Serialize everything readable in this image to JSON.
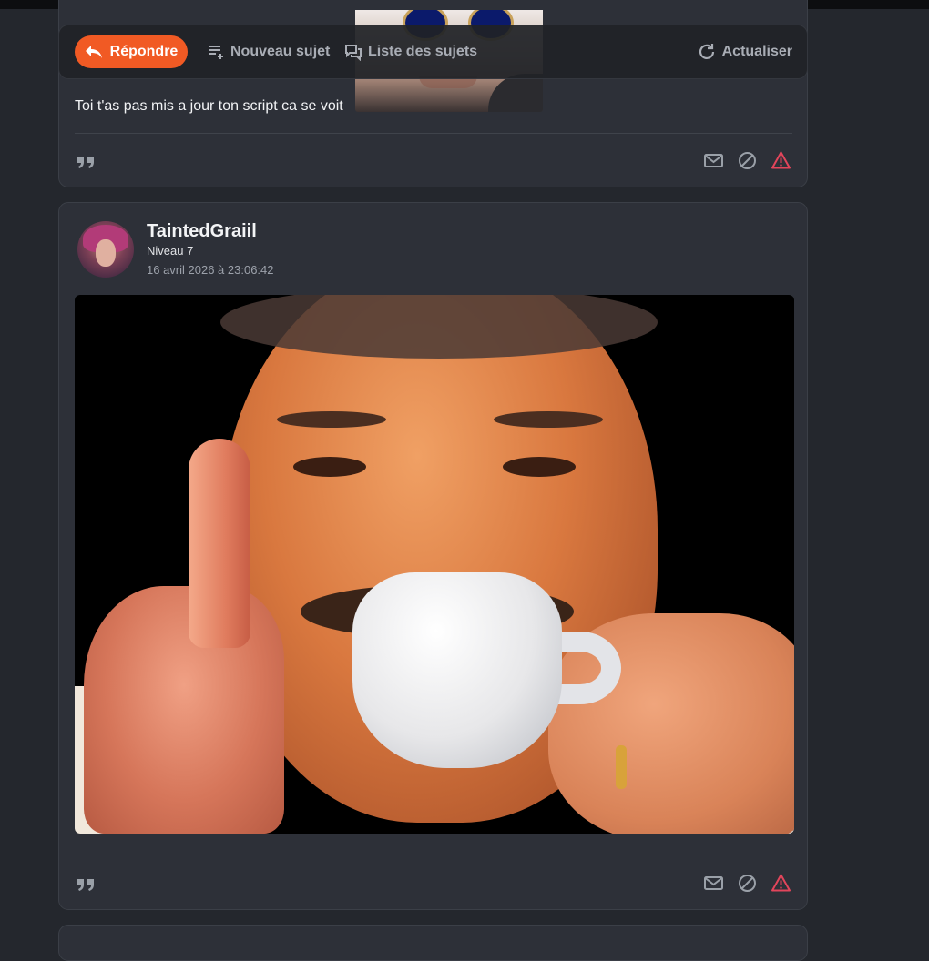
{
  "toolbar": {
    "reply_label": "Répondre",
    "new_topic_label": "Nouveau sujet",
    "topic_list_label": "Liste des sujets",
    "refresh_label": "Actualiser",
    "reply_color": "#f15a24"
  },
  "posts": [
    {
      "text": "Toi t'as pas mis a jour ton script ca se voit",
      "actions": [
        "quote-icon",
        "mail-icon",
        "block-icon",
        "report-icon"
      ]
    },
    {
      "username": "TaintedGraiil",
      "level": "Niveau 7",
      "date": "16 avril 2026 à 23:06:42",
      "actions": [
        "quote-icon",
        "mail-icon",
        "block-icon",
        "report-icon"
      ]
    }
  ],
  "colors": {
    "background": "#24272d",
    "card": "#2d3038",
    "report": "#e2455b"
  }
}
